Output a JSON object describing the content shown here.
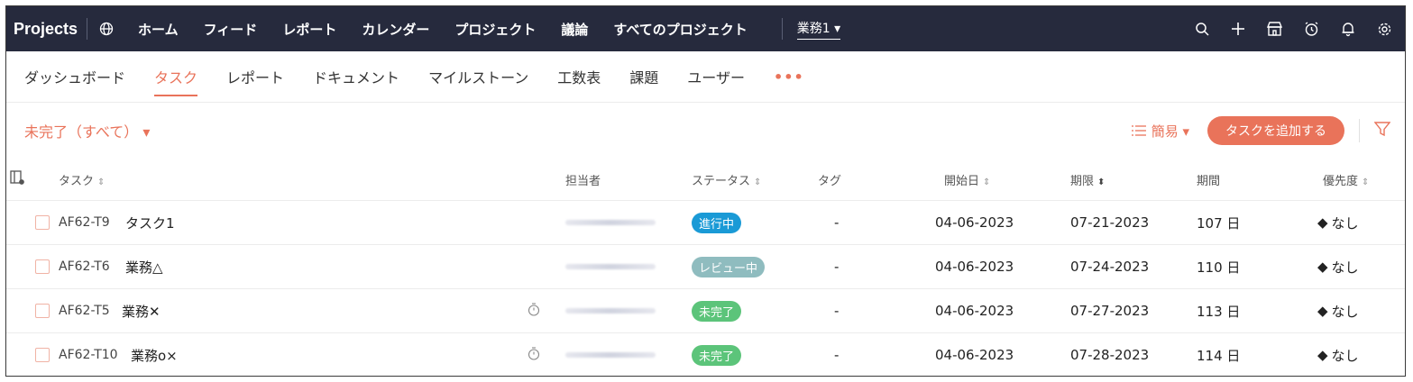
{
  "app": {
    "brand": "Projects"
  },
  "topnav": {
    "items": [
      "ホーム",
      "フィード",
      "レポート",
      "カレンダー",
      "プロジェクト",
      "議論",
      "すべてのプロジェクト"
    ],
    "workspace": "業務1 ▾"
  },
  "subnav": {
    "items": [
      "ダッシュボード",
      "タスク",
      "レポート",
      "ドキュメント",
      "マイルストーン",
      "工数表",
      "課題",
      "ユーザー"
    ],
    "active_index": 1,
    "more": "•••"
  },
  "filterbar": {
    "filter_label": "未完了（すべて） ▾",
    "view_label": "簡易 ▾",
    "add_button": "タスクを追加する"
  },
  "table": {
    "headers": {
      "task": "タスク",
      "assignee": "担当者",
      "status": "ステータス",
      "tag": "タグ",
      "start": "開始日",
      "due": "期限",
      "duration": "期間",
      "priority": "優先度"
    },
    "rows": [
      {
        "id": "AF62-T9",
        "name": "タスク1",
        "timer": false,
        "status": "進行中",
        "status_color": "#1a9ad6",
        "tag": "-",
        "start": "04-06-2023",
        "due": "07-21-2023",
        "duration": "107 日",
        "priority": "なし"
      },
      {
        "id": "AF62-T6",
        "name": "業務△",
        "timer": false,
        "status": "レビュー中",
        "status_color": "#8fbcbf",
        "tag": "-",
        "start": "04-06-2023",
        "due": "07-24-2023",
        "duration": "110 日",
        "priority": "なし"
      },
      {
        "id": "AF62-T5",
        "name": "業務✕",
        "timer": true,
        "status": "未完了",
        "status_color": "#5cc47a",
        "tag": "-",
        "start": "04-06-2023",
        "due": "07-27-2023",
        "duration": "113 日",
        "priority": "なし"
      },
      {
        "id": "AF62-T10",
        "name": "業務o×",
        "timer": true,
        "status": "未完了",
        "status_color": "#5cc47a",
        "tag": "-",
        "start": "04-06-2023",
        "due": "07-28-2023",
        "duration": "114 日",
        "priority": "なし"
      }
    ]
  },
  "colors": {
    "topbar": "#262a3d",
    "accent": "#e9735a"
  }
}
